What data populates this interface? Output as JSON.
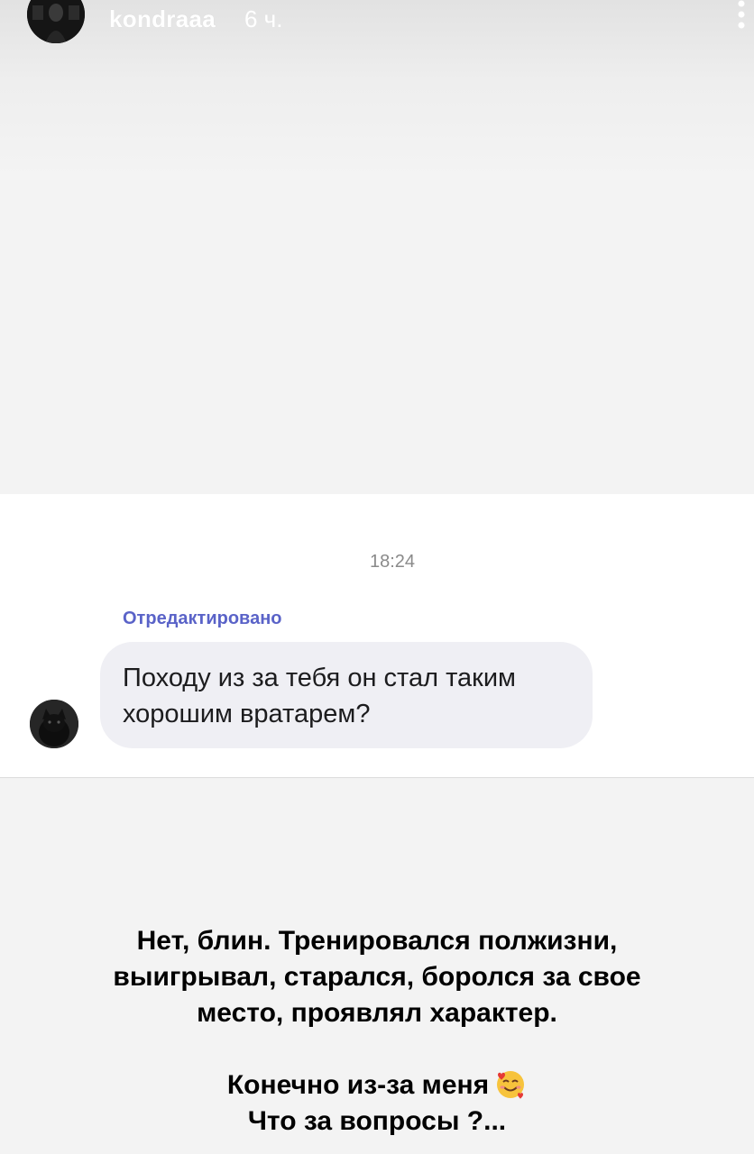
{
  "story_header": {
    "username": "kondraaa",
    "time_ago": "6 ч."
  },
  "chat": {
    "timestamp": "18:24",
    "edited_label": "Отредактировано",
    "message_line_1": "Походу из за тебя он стал таким",
    "message_line_2": "хорошим вратарем?"
  },
  "caption": {
    "line_1": "Нет, блин. Тренировался полжизни,",
    "line_2": "выигрывал, старался, боролся за свое",
    "line_3": "место, проявлял характер.",
    "line_4": "Конечно из-за меня",
    "line_4_emoji": "smiling-face-with-hearts-icon",
    "line_5": "Что за вопросы ?..."
  },
  "colors": {
    "edited_label": "#5a63c8",
    "bubble_background": "#efeff4",
    "page_background": "#f3f3f3"
  }
}
